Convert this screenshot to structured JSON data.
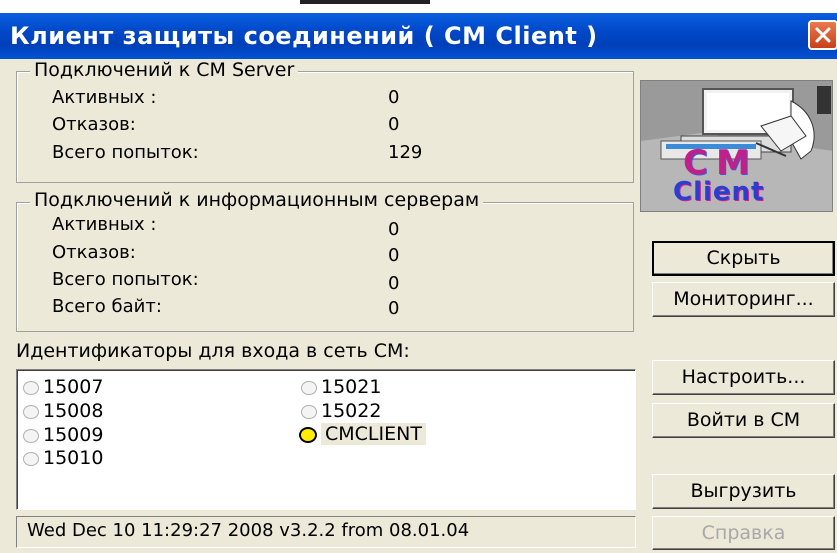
{
  "window": {
    "title": "Клиент защиты соединений ( CM Client )"
  },
  "server_group": {
    "legend": "Подключений к CM Server",
    "rows": [
      {
        "label": "Активных :",
        "value": "0"
      },
      {
        "label": "Отказов:",
        "value": "0"
      },
      {
        "label": "Всего попыток:",
        "value": "129"
      }
    ]
  },
  "info_group": {
    "legend": "Подключений к информационным серверам",
    "rows": [
      {
        "label": "Активных :",
        "value": "0"
      },
      {
        "label": "Отказов:",
        "value": "0"
      },
      {
        "label": "Всего попыток:",
        "value": "0"
      },
      {
        "label": "Всего байт:",
        "value": "0"
      }
    ]
  },
  "ids_label": "Идентификаторы для входа в сеть СМ:",
  "ids": [
    {
      "id": "15007",
      "active": false
    },
    {
      "id": "15008",
      "active": false
    },
    {
      "id": "15009",
      "active": false
    },
    {
      "id": "15010",
      "active": false
    },
    {
      "id": "15021",
      "active": false
    },
    {
      "id": "15022",
      "active": false
    },
    {
      "id": "CMCLIENT",
      "active": true
    }
  ],
  "status_text": "Wed Dec 10 11:29:27 2008 v3.2.2 from 08.01.04",
  "logo": {
    "line1": "CM",
    "line2": "Client"
  },
  "buttons": {
    "hide": "Скрыть",
    "monitoring": "Мониторинг...",
    "configure": "Настроить...",
    "login": "Войти в СМ",
    "unload": "Выгрузить",
    "help": "Справка"
  },
  "colors": {
    "title_bar": "#0048c8",
    "window_bg": "#ece9d8",
    "active_indicator": "#ffee00",
    "close_button": "#d9572f"
  }
}
